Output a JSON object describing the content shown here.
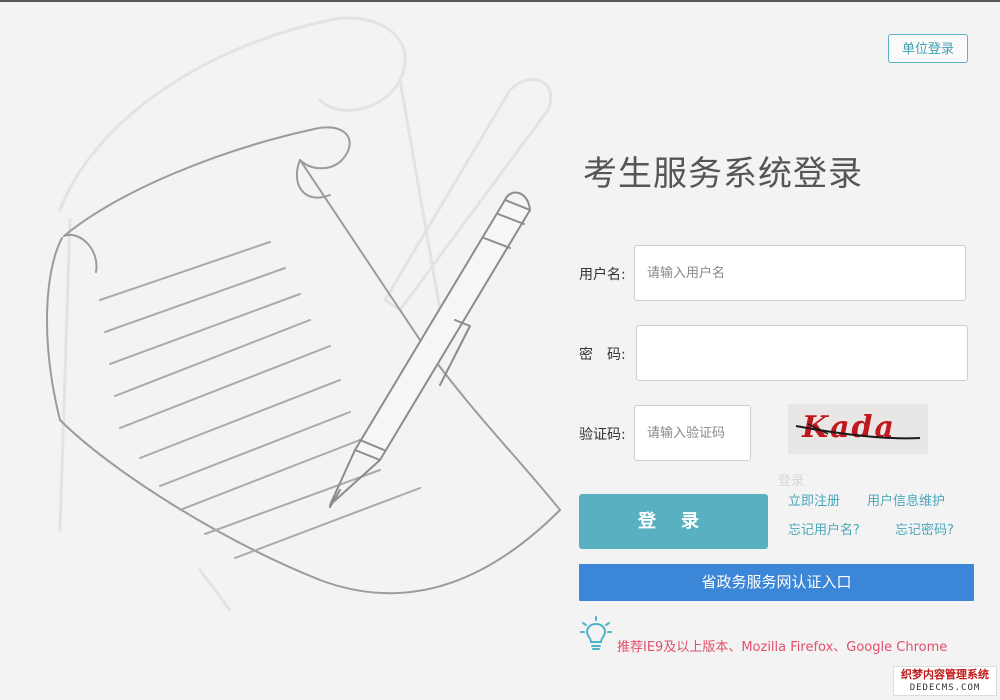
{
  "header": {
    "unit_login": "单位登录"
  },
  "form": {
    "title": "考生服务系统登录",
    "username": {
      "label": "用户名:",
      "placeholder": "请输入用户名",
      "value": ""
    },
    "password": {
      "label": "密　码:",
      "value": ""
    },
    "captcha": {
      "label": "验证码:",
      "placeholder": "请输入验证码",
      "value": "",
      "image_text": "Kada",
      "faint_text": "登录"
    },
    "login_button": "登 录",
    "links": {
      "register": "立即注册",
      "user_info": "用户信息维护",
      "forgot_username": "忘记用户名?",
      "forgot_password": "忘记密码?"
    },
    "gov_entry": "省政务服务网认证入口",
    "browser_tip": "推荐IE9及以上版本、Mozilla Firefox、Google Chrome"
  },
  "watermark": {
    "line1": "织梦内容管理系统",
    "line2": "DEDECMS.COM"
  },
  "colors": {
    "accent": "#57b1c0",
    "gov_blue": "#3b86d6",
    "tip_pink": "#e0506e",
    "captcha_red": "#c0181e"
  },
  "icons": {
    "illustration": "paper-and-pen-illustration",
    "tip": "lightbulb-icon"
  }
}
